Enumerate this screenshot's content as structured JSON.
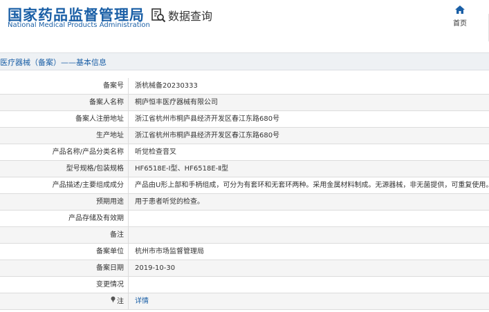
{
  "header": {
    "logo_cn": "国家药品监督管理局",
    "logo_en": "National Medical Products Administration",
    "query_label": "数据查询",
    "home_label": "首页"
  },
  "section": {
    "title": "医疗器械（备案）——基本信息"
  },
  "rows": [
    {
      "label": "备案号",
      "value": "浙杭械备20230333"
    },
    {
      "label": "备案人名称",
      "value": "桐庐恒丰医疗器械有限公司"
    },
    {
      "label": "备案人注册地址",
      "value": "浙江省杭州市桐庐县经济开发区春江东路680号"
    },
    {
      "label": "生产地址",
      "value": "浙江省杭州市桐庐县经济开发区春江东路680号"
    },
    {
      "label": "产品名称/产品分类名称",
      "value": "听觉检查音叉"
    },
    {
      "label": "型号规格/包装规格",
      "value": "HF6518E-Ⅰ型、HF6518E-Ⅱ型"
    },
    {
      "label": "产品描述/主要组成成分",
      "value": "产品由U形上部和手柄组成，可分为有套环和无套环两种。采用金属材料制成。无源器械，非无菌提供，可重复使用。"
    },
    {
      "label": "预期用途",
      "value": "用于患者听觉的检查。"
    },
    {
      "label": "产品存储及有效期",
      "value": ""
    },
    {
      "label": "备注",
      "value": ""
    },
    {
      "label": "备案单位",
      "value": "杭州市市场监督管理局"
    },
    {
      "label": "备案日期",
      "value": "2019-10-30"
    },
    {
      "label": "变更情况",
      "value": ""
    }
  ],
  "note_row": {
    "label": "注",
    "link": "详情"
  },
  "colors": {
    "brand_blue": "#1a5fa6",
    "section_bg": "#eef1f4",
    "stripe_bg": "#f5f5f5"
  },
  "icons": {
    "query": "search-document-icon",
    "home": "home-icon",
    "note": "pin-icon"
  }
}
